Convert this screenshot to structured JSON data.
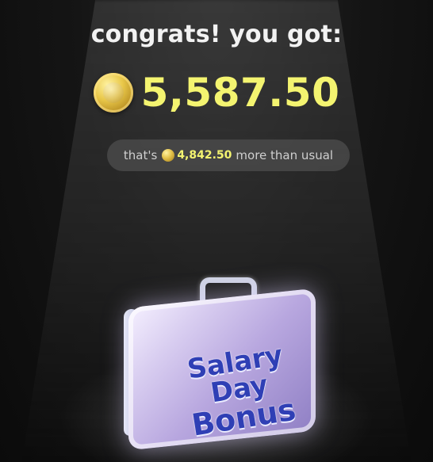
{
  "title": "congrats! you got:",
  "reward": {
    "amount": "5,587.50",
    "coin_icon": "gold-coin-icon"
  },
  "comparison": {
    "prefix": "that's",
    "value": "4,842.50",
    "suffix": "more than usual"
  },
  "briefcase": {
    "line1": "Salary Day",
    "line2": "Bonus"
  },
  "colors": {
    "amount": "#f4f470",
    "background": "#0b0b0b",
    "case_text": "#2f3fb5"
  }
}
